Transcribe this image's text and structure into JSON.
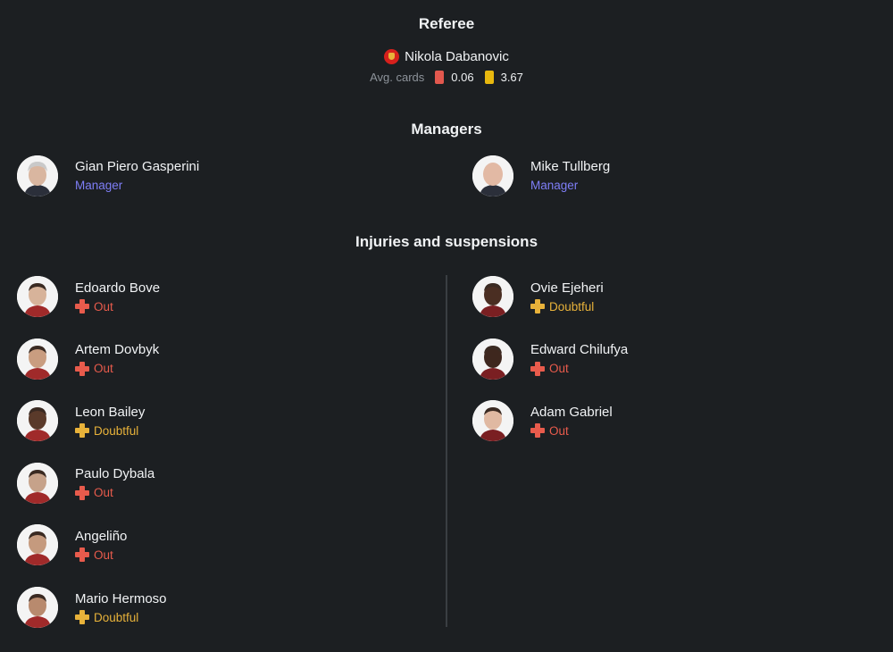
{
  "referee": {
    "title": "Referee",
    "name": "Nikola Dabanovic",
    "flag_icon": "montenegro-flag-icon",
    "avg_cards_label": "Avg. cards",
    "red_avg": "0.06",
    "yellow_avg": "3.67"
  },
  "managers": {
    "title": "Managers",
    "home": {
      "name": "Gian Piero Gasperini",
      "role": "Manager"
    },
    "away": {
      "name": "Mike Tullberg",
      "role": "Manager"
    }
  },
  "injuries": {
    "title": "Injuries and suspensions",
    "home": [
      {
        "name": "Edoardo Bove",
        "status": "Out"
      },
      {
        "name": "Artem Dovbyk",
        "status": "Out"
      },
      {
        "name": "Leon Bailey",
        "status": "Doubtful"
      },
      {
        "name": "Paulo Dybala",
        "status": "Out"
      },
      {
        "name": "Angeliño",
        "status": "Out"
      },
      {
        "name": "Mario Hermoso",
        "status": "Doubtful"
      }
    ],
    "away": [
      {
        "name": "Ovie Ejeheri",
        "status": "Doubtful"
      },
      {
        "name": "Edward Chilufya",
        "status": "Out"
      },
      {
        "name": "Adam Gabriel",
        "status": "Out"
      }
    ]
  },
  "colors": {
    "background": "#1c1f22",
    "manager_role": "#7e7ef7",
    "out": "#e85b4c",
    "doubtful": "#e8b23a",
    "red_card": "#e2584e",
    "yellow_card": "#e8b80e"
  }
}
